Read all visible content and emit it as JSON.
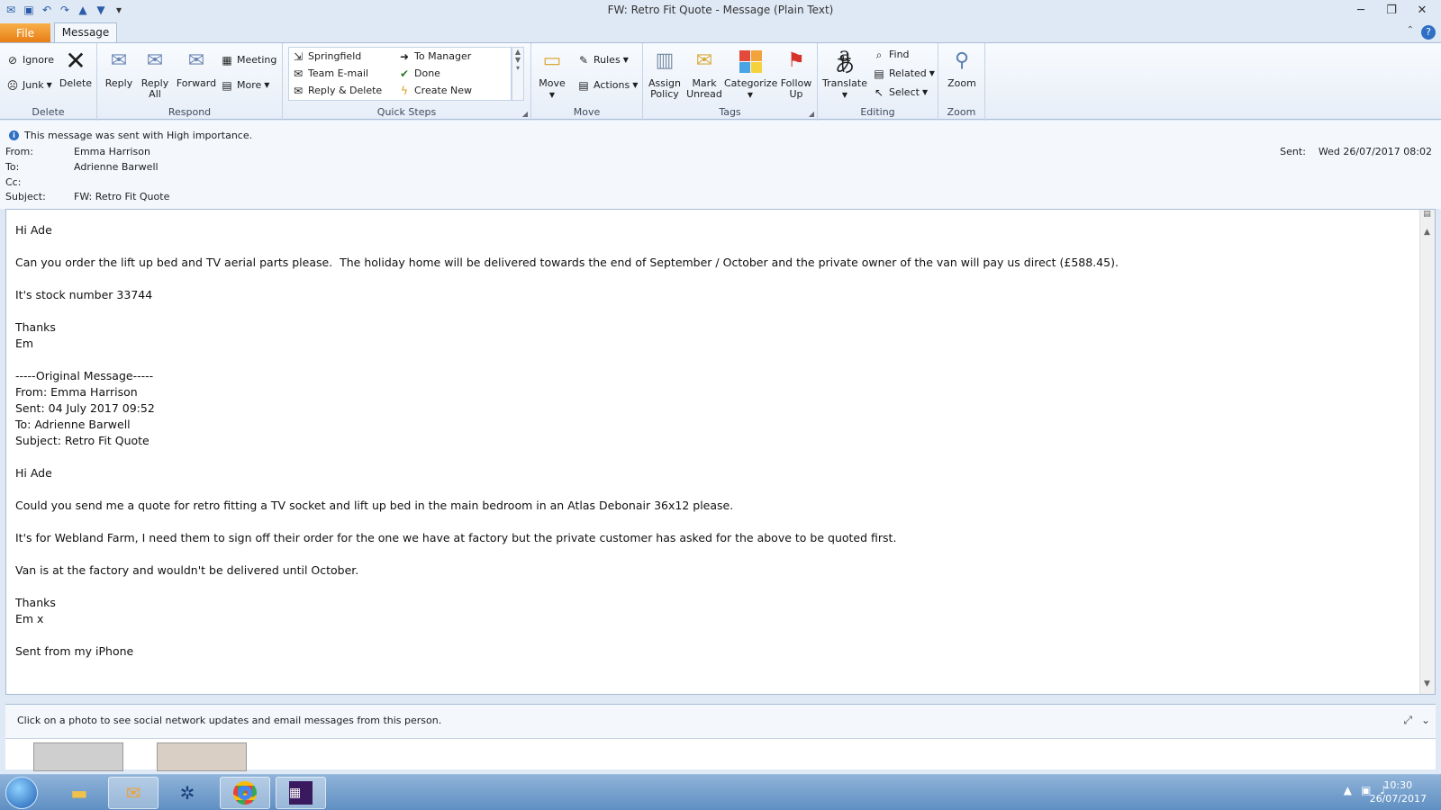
{
  "window": {
    "title": "FW: Retro Fit Quote  -  Message (Plain Text)"
  },
  "tabs": {
    "file": "File",
    "message": "Message"
  },
  "ribbon": {
    "delete_group": {
      "label": "Delete",
      "ignore": "Ignore",
      "junk": "Junk",
      "delete": "Delete"
    },
    "respond_group": {
      "label": "Respond",
      "reply": "Reply",
      "reply_all_1": "Reply",
      "reply_all_2": "All",
      "forward": "Forward",
      "meeting": "Meeting",
      "more": "More"
    },
    "quicksteps_group": {
      "label": "Quick Steps",
      "items": [
        "Springfield",
        "Team E-mail",
        "Reply & Delete",
        "To Manager",
        "Done",
        "Create New"
      ]
    },
    "move_group": {
      "label": "Move",
      "move": "Move",
      "rules": "Rules",
      "actions": "Actions"
    },
    "tags_group": {
      "label": "Tags",
      "assign_1": "Assign",
      "assign_2": "Policy",
      "mark_1": "Mark",
      "mark_2": "Unread",
      "categorize": "Categorize",
      "follow_1": "Follow",
      "follow_2": "Up"
    },
    "editing_group": {
      "label": "Editing",
      "translate": "Translate",
      "find": "Find",
      "related": "Related",
      "select": "Select"
    },
    "zoom_group": {
      "label": "Zoom",
      "zoom": "Zoom"
    }
  },
  "header": {
    "info": "This message was sent with High importance.",
    "from_label": "From:",
    "from": "Emma Harrison",
    "to_label": "To:",
    "to": "Adrienne Barwell",
    "cc_label": "Cc:",
    "cc": "",
    "subject_label": "Subject:",
    "subject": "FW: Retro Fit Quote",
    "sent_label": "Sent:",
    "sent": "Wed 26/07/2017 08:02"
  },
  "body": {
    "lines": [
      "Hi Ade",
      "",
      "Can you order the lift up bed and TV aerial parts please.  The holiday home will be delivered towards the end of September / October and the private owner of the van will pay us direct (£588.45).",
      "",
      "It's stock number 33744",
      "",
      "Thanks",
      "Em",
      "",
      "-----Original Message-----",
      "From: Emma Harrison",
      "Sent: 04 July 2017 09:52",
      "To: Adrienne Barwell",
      "Subject: Retro Fit Quote",
      "",
      "Hi Ade",
      "",
      "Could you send me a quote for retro fitting a TV socket and lift up bed in the main bedroom in an Atlas Debonair 36x12 please.",
      "",
      "It's for Webland Farm, I need them to sign off their order for the one we have at factory but the private customer has asked for the above to be quoted first.",
      "",
      "Van is at the factory and wouldn't be delivered until October.",
      "",
      "Thanks",
      "Em x",
      "",
      "Sent from my iPhone"
    ]
  },
  "people_pane": {
    "text": "Click on a photo to see social network updates and email messages from this person."
  },
  "taskbar": {
    "time": "10:30",
    "date": "26/07/2017"
  }
}
